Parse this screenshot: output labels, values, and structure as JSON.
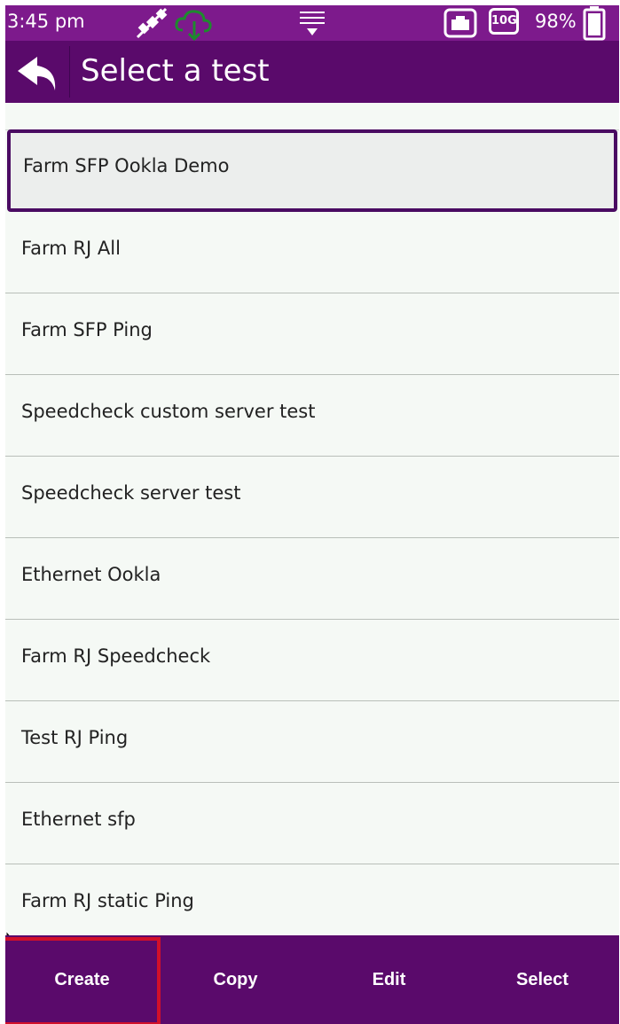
{
  "status_bar": {
    "time": "3:45 pm",
    "speed_badge": "10G",
    "battery_percent": "98%"
  },
  "header": {
    "title": "Select a test"
  },
  "tests": [
    {
      "label": "Farm SFP Ookla Demo",
      "selected": true
    },
    {
      "label": "Farm RJ All"
    },
    {
      "label": "Farm SFP Ping"
    },
    {
      "label": "Speedcheck custom server test"
    },
    {
      "label": "Speedcheck server test"
    },
    {
      "label": "Ethernet Ookla"
    },
    {
      "label": "Farm RJ Speedcheck"
    },
    {
      "label": "Test RJ Ping"
    },
    {
      "label": "Ethernet sfp"
    },
    {
      "label": "Farm RJ static Ping"
    }
  ],
  "bottom_bar": {
    "create": "Create",
    "copy": "Copy",
    "edit": "Edit",
    "select": "Select"
  },
  "colors": {
    "status_bar": "#7d1a8c",
    "header": "#5a0a6b",
    "highlight": "#d1102a"
  }
}
